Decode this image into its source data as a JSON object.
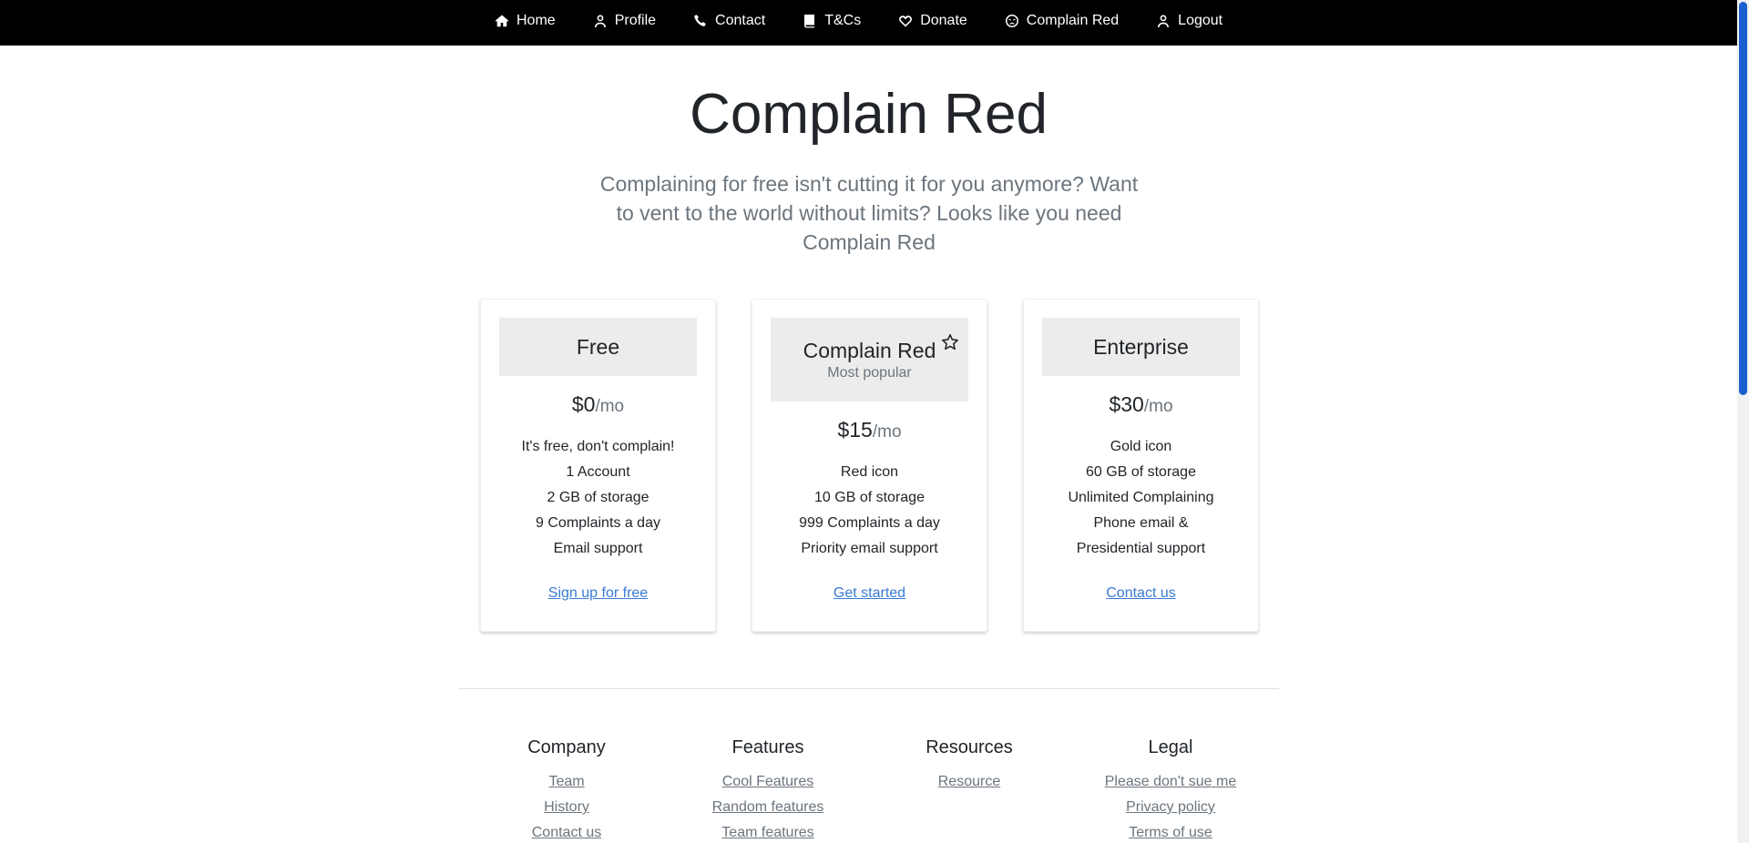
{
  "nav": {
    "items": [
      {
        "label": "Home",
        "icon": "home-icon"
      },
      {
        "label": "Profile",
        "icon": "user-icon"
      },
      {
        "label": "Contact",
        "icon": "phone-icon"
      },
      {
        "label": "T&Cs",
        "icon": "book-icon"
      },
      {
        "label": "Donate",
        "icon": "heart-icon"
      },
      {
        "label": "Complain Red",
        "icon": "angry-face-icon"
      },
      {
        "label": "Logout",
        "icon": "user-icon"
      }
    ]
  },
  "hero": {
    "title": "Complain Red",
    "subtitle": "Complaining for free isn't cutting it for you anymore? Want to vent to the world without limits? Looks like you need Complain Red"
  },
  "plans": [
    {
      "title": "Free",
      "tag": "",
      "price": "$0",
      "per": "/mo",
      "features": [
        "It's free, don't complain!",
        "1 Account",
        "2 GB of storage",
        "9 Complaints a day",
        "Email support"
      ],
      "cta": "Sign up for free"
    },
    {
      "title": "Complain Red",
      "tag": "Most popular",
      "price": "$15",
      "per": "/mo",
      "features": [
        "Red icon",
        "10 GB of storage",
        "999 Complaints a day",
        "Priority email support"
      ],
      "cta": "Get started"
    },
    {
      "title": "Enterprise",
      "tag": "",
      "price": "$30",
      "per": "/mo",
      "features": [
        "Gold icon",
        "60 GB of storage",
        "Unlimited Complaining",
        "Phone email &",
        "Presidential support"
      ],
      "cta": "Contact us"
    }
  ],
  "footer": {
    "columns": [
      {
        "heading": "Company",
        "links": [
          "Team",
          "History",
          "Contact us"
        ]
      },
      {
        "heading": "Features",
        "links": [
          "Cool Features",
          "Random features",
          "Team features"
        ]
      },
      {
        "heading": "Resources",
        "links": [
          "Resource"
        ]
      },
      {
        "heading": "Legal",
        "links": [
          "Please don't sue me",
          "Privacy policy",
          "Terms of use"
        ]
      }
    ]
  },
  "colors": {
    "nav_bg": "#000000",
    "link": "#3a7bd5",
    "card_header_bg": "#ececec",
    "scroll_thumb": "#1a5fd0"
  }
}
